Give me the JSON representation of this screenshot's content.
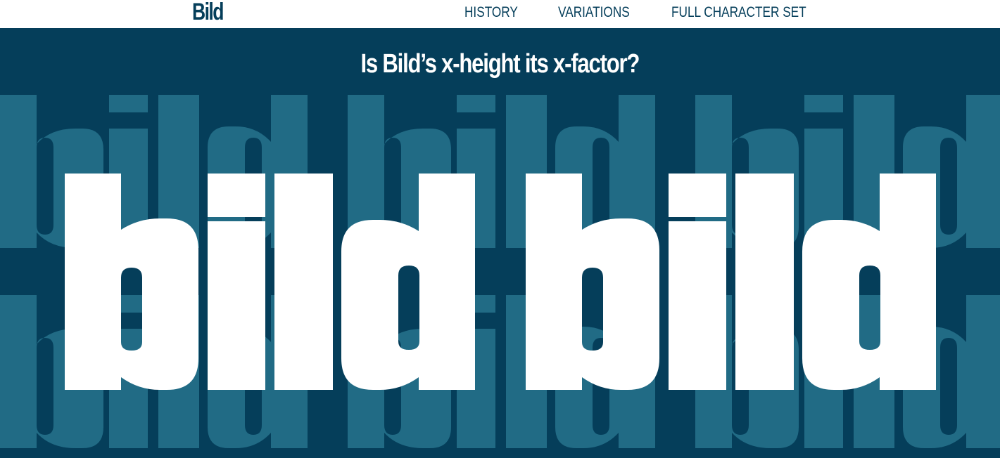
{
  "header": {
    "logo": "Bild",
    "nav": [
      {
        "label": "HISTORY"
      },
      {
        "label": "VARIATIONS"
      },
      {
        "label": "FULL CHARACTER SET"
      }
    ]
  },
  "hero": {
    "headline": "Is Bild’s x-height its x-factor?",
    "word": "bild",
    "colors": {
      "background": "#053e5a",
      "pattern": "#216b85",
      "foreground": "#ffffff"
    }
  }
}
